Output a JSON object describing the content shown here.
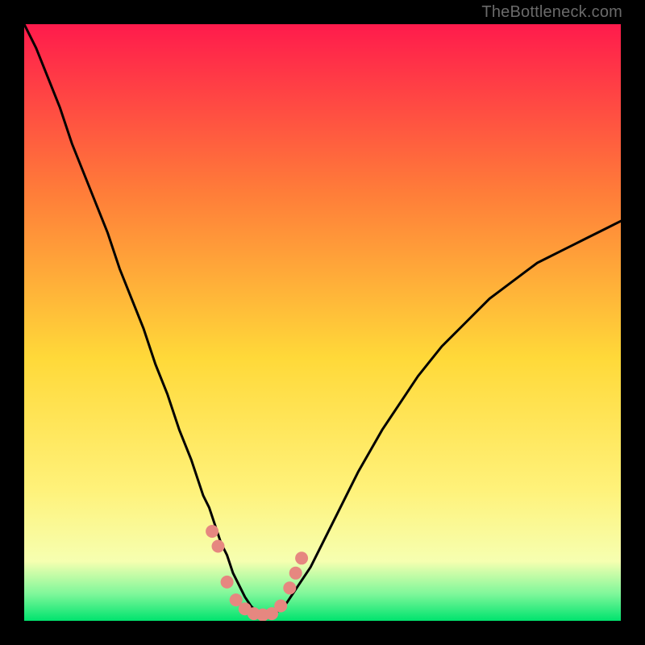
{
  "watermark": "TheBottleneck.com",
  "colors": {
    "grad_top": "#ff1b4c",
    "grad_mid_upper": "#ff7c39",
    "grad_mid": "#ffd939",
    "grad_mid_lower": "#fff27a",
    "grad_lower": "#f6ffb0",
    "grad_green_light": "#7ef79a",
    "grad_green": "#00e36e",
    "curve": "#000000",
    "dots": "#e68780"
  },
  "chart_data": {
    "type": "line",
    "title": "",
    "xlabel": "",
    "ylabel": "",
    "xlim": [
      0,
      100
    ],
    "ylim": [
      0,
      100
    ],
    "x": [
      0,
      2,
      4,
      6,
      8,
      10,
      12,
      14,
      16,
      18,
      20,
      22,
      24,
      26,
      28,
      30,
      31,
      32,
      33,
      34,
      35,
      36,
      37,
      38,
      39,
      40,
      41,
      42,
      43,
      44,
      46,
      48,
      50,
      52,
      54,
      56,
      58,
      60,
      62,
      64,
      66,
      68,
      70,
      72,
      74,
      76,
      78,
      80,
      82,
      84,
      86,
      88,
      90,
      92,
      94,
      96,
      98,
      100
    ],
    "series": [
      {
        "name": "bottleneck-curve",
        "values": [
          100,
          96,
          91,
          86,
          80,
          75,
          70,
          65,
          59,
          54,
          49,
          43,
          38,
          32,
          27,
          21,
          19,
          16,
          13,
          11,
          8,
          6,
          4,
          2.5,
          1.5,
          1,
          1,
          1.2,
          2,
          3,
          6,
          9,
          13,
          17,
          21,
          25,
          28.5,
          32,
          35,
          38,
          41,
          43.5,
          46,
          48,
          50,
          52,
          54,
          55.5,
          57,
          58.5,
          60,
          61,
          62,
          63,
          64,
          65,
          66,
          67
        ]
      }
    ],
    "scatter": {
      "name": "highlight-dots",
      "points": [
        {
          "x": 31.5,
          "y": 15
        },
        {
          "x": 32.5,
          "y": 12.5
        },
        {
          "x": 34,
          "y": 6.5
        },
        {
          "x": 35.5,
          "y": 3.5
        },
        {
          "x": 37,
          "y": 2
        },
        {
          "x": 38.5,
          "y": 1.2
        },
        {
          "x": 40,
          "y": 1
        },
        {
          "x": 41.5,
          "y": 1.2
        },
        {
          "x": 43,
          "y": 2.5
        },
        {
          "x": 44.5,
          "y": 5.5
        },
        {
          "x": 45.5,
          "y": 8
        },
        {
          "x": 46.5,
          "y": 10.5
        }
      ]
    }
  }
}
